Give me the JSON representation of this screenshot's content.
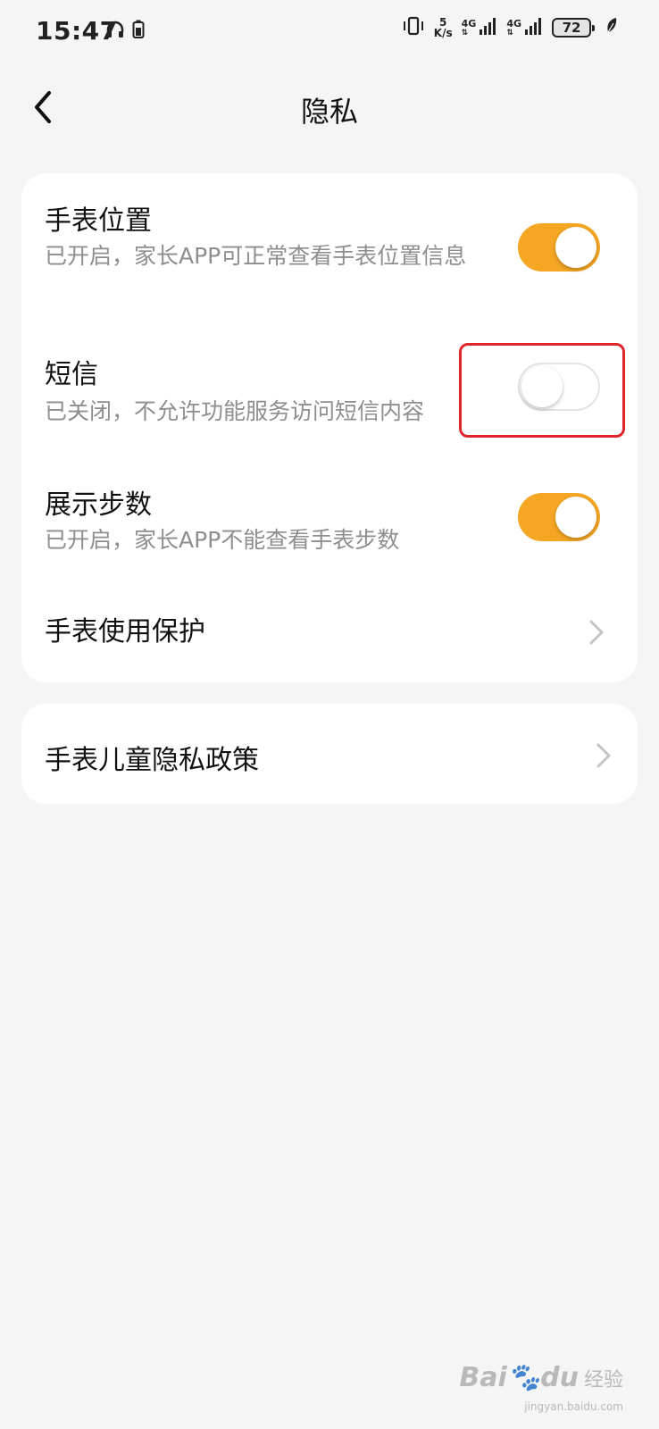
{
  "status_bar": {
    "time": "15:47",
    "speed_value": "5",
    "speed_unit": "K/s",
    "net1": "4G",
    "net2": "4G",
    "battery": "72",
    "icons": [
      "headphones-icon",
      "battery-saver-icon",
      "vibrate-icon",
      "signal-icon",
      "leaf-icon"
    ]
  },
  "header": {
    "title": "隐私",
    "back_icon": "chevron-left-icon"
  },
  "settings": [
    {
      "title": "手表位置",
      "desc": "已开启，家长APP可正常查看手表位置信息",
      "enabled": true
    },
    {
      "title": "短信",
      "desc": "已关闭，不允许功能服务访问短信内容",
      "enabled": false
    },
    {
      "title": "展示步数",
      "desc": "已开启，家长APP不能查看手表步数",
      "enabled": true
    },
    {
      "title": "手表使用保护"
    }
  ],
  "policy": {
    "title": "手表儿童隐私政策"
  },
  "colors": {
    "toggle_on": "#f5a623",
    "highlight": "#e0242c",
    "background": "#f5f5f5"
  },
  "watermark": {
    "logo": "Bai",
    "logo_suffix": "du",
    "text": "经验",
    "sub": "jingyan.baidu.com"
  }
}
